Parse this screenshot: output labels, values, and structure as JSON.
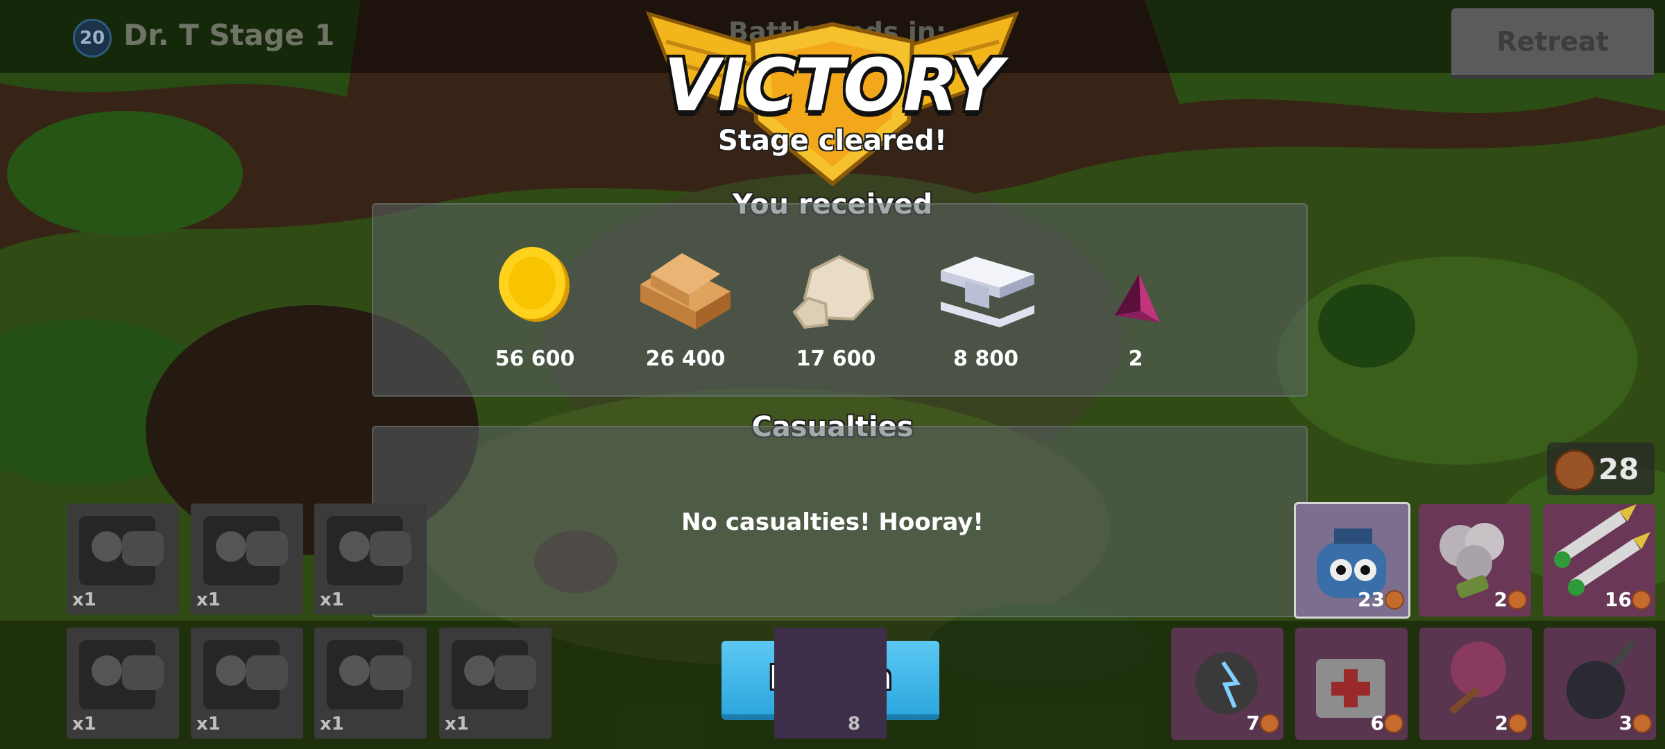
{
  "header": {
    "level": "20",
    "stage_name": "Dr. T Stage 1",
    "battle_timer_label": "Battle ends in:",
    "retreat_label": "Retreat"
  },
  "result": {
    "title": "VICTORY",
    "subtitle": "Stage cleared!"
  },
  "rewards": {
    "heading": "You received",
    "items": [
      {
        "icon": "gold-coin-icon",
        "amount": "56 600"
      },
      {
        "icon": "wood-icon",
        "amount": "26 400"
      },
      {
        "icon": "stone-icon",
        "amount": "17 600"
      },
      {
        "icon": "iron-icon",
        "amount": "8 800"
      },
      {
        "icon": "power-stone-icon",
        "amount": "2"
      }
    ]
  },
  "casualties": {
    "heading": "Casualties",
    "message": "No casualties! Hooray!"
  },
  "return_label": "Return",
  "troops": [
    {
      "count": "x1"
    },
    {
      "count": "x1"
    },
    {
      "count": "x1"
    },
    {
      "count": "x1"
    },
    {
      "count": "x1"
    },
    {
      "count": "x1"
    },
    {
      "count": "x1"
    }
  ],
  "hidden_card_count": "8",
  "energy": "28",
  "abilities": [
    {
      "icon": "robot-icon",
      "count": "23"
    },
    {
      "icon": "smoke-screen-icon",
      "count": "2"
    },
    {
      "icon": "barrage-icon",
      "count": "16"
    },
    {
      "icon": "shock-bomb-icon",
      "count": "7"
    },
    {
      "icon": "medkit-icon",
      "count": "6"
    },
    {
      "icon": "flare-icon",
      "count": "2"
    },
    {
      "icon": "bomb-icon",
      "count": "3"
    }
  ],
  "colors": {
    "return_button": "#2da7e0",
    "victory_gold": "#f2b51c"
  }
}
